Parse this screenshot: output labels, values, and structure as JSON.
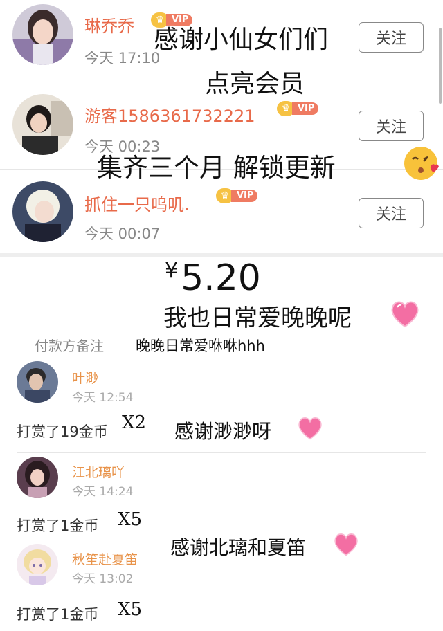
{
  "follow_label": "关注",
  "vip_badge": "VIP",
  "users": [
    {
      "name": "琳乔乔",
      "time": "今天 17:10"
    },
    {
      "name": "游客1586361732221",
      "time": "今天 00:23"
    },
    {
      "name": "抓住一只呜叽.",
      "time": "今天 00:07"
    }
  ],
  "overlay": {
    "line1": "感谢小仙女们们",
    "line2": "点亮会员",
    "line3": "集齐三个月 解锁更新",
    "line4": "我也日常爱晚晚呢",
    "thanks1": "感谢渺渺呀",
    "thanks2": "感谢北璃和夏笛"
  },
  "payment": {
    "currency": "¥",
    "amount": "5.20",
    "note_label": "付款方备注",
    "note": "晚晚日常爱咻咻hhh"
  },
  "rewards": [
    {
      "name": "叶渺",
      "time": "今天 12:54",
      "text": "打赏了19金币",
      "mult": "X2"
    },
    {
      "name": "江北璃吖",
      "time": "今天 14:24",
      "text": "打赏了1金币",
      "mult": "X5"
    },
    {
      "name": "秋笙赴夏笛",
      "time": "今天 13:02",
      "text": "打赏了1金币",
      "mult": "X5"
    }
  ],
  "colors": {
    "name": "#e86a4a",
    "reward_name": "#e8934a",
    "vip": "#ef7b62",
    "crown": "#f6c243",
    "heart": "#f36ea3"
  }
}
